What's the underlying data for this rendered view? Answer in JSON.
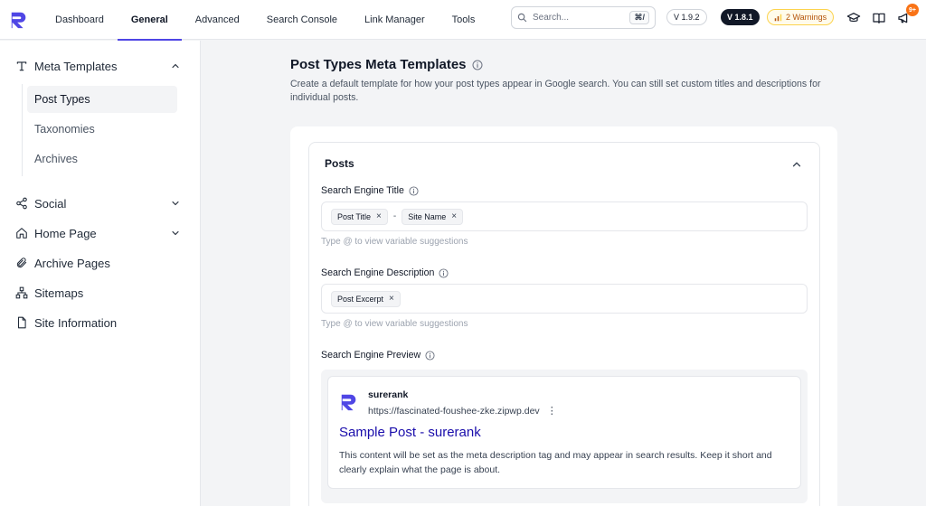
{
  "nav": {
    "tabs": [
      {
        "label": "Dashboard"
      },
      {
        "label": "General"
      },
      {
        "label": "Advanced"
      },
      {
        "label": "Search Console"
      },
      {
        "label": "Link Manager"
      },
      {
        "label": "Tools"
      }
    ],
    "active_tab": "General",
    "search": {
      "placeholder": "Search...",
      "shortcut": "⌘/"
    },
    "version_light": "V 1.9.2",
    "version_dark": "V 1.8.1",
    "warnings": "2 Warnings",
    "notification_badge": "9+",
    "brand_color": "#4f46e5"
  },
  "sidebar": {
    "meta_templates": "Meta Templates",
    "sub": [
      {
        "label": "Post Types"
      },
      {
        "label": "Taxonomies"
      },
      {
        "label": "Archives"
      }
    ],
    "active_sub": "Post Types",
    "items": [
      {
        "label": "Social"
      },
      {
        "label": "Home Page"
      },
      {
        "label": "Archive Pages"
      },
      {
        "label": "Sitemaps"
      },
      {
        "label": "Site Information"
      }
    ]
  },
  "main": {
    "title": "Post Types Meta Templates",
    "description": "Create a default template for how your post types appear in Google search. You can still set custom titles and descriptions for individual posts.",
    "section": "Posts",
    "title_field": {
      "label": "Search Engine Title",
      "chips": [
        "Post Title",
        "Site Name"
      ],
      "separator": "-",
      "hint": "Type @ to view variable suggestions"
    },
    "desc_field": {
      "label": "Search Engine Description",
      "chips": [
        "Post Excerpt"
      ],
      "hint": "Type @ to view variable suggestions"
    },
    "preview": {
      "label": "Search Engine Preview",
      "site": "surerank",
      "url": "https://fascinated-foushee-zke.zipwp.dev",
      "title": "Sample Post - surerank",
      "description": "This content will be set as the meta description tag and may appear in search results. Keep it short and clearly explain what the page is about."
    }
  }
}
